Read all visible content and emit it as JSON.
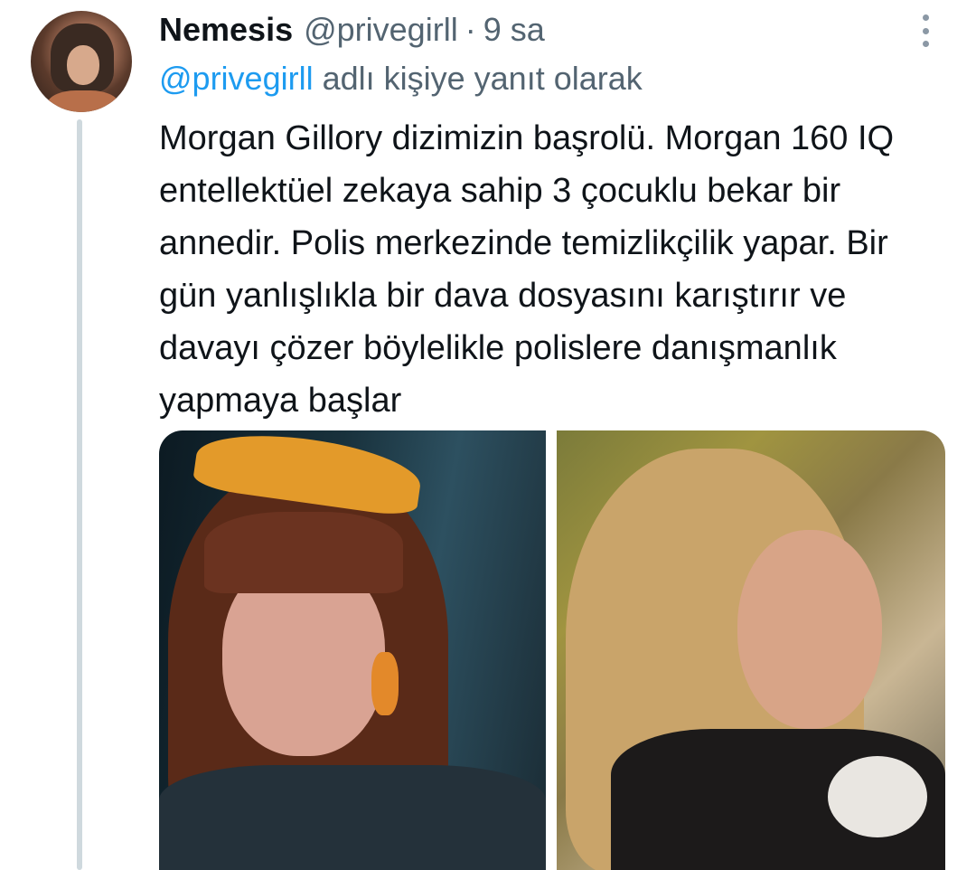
{
  "tweet": {
    "author_name": "Nemesis",
    "author_handle": "@privegirll",
    "separator": "·",
    "timestamp": "9 sa",
    "reply_to": {
      "mention": "@privegirll",
      "suffix": " adlı kişiye yanıt olarak"
    },
    "text": "Morgan Gillory dizimizin başrolü. Morgan 160 IQ entellektüel zekaya sahip 3 çocuklu bekar bir annedir. Polis merkezinde temizlikçilik yapar. Bir gün yanlışlıkla bir dava dosyasını karıştırır ve davayı çözer böylelikle polislere danışmanlık yapmaya başlar",
    "icons": {
      "more": "more-options-icon"
    },
    "colors": {
      "link": "#1d9bf0",
      "secondary_text": "#536471",
      "thread_line": "#cfd9de"
    }
  }
}
